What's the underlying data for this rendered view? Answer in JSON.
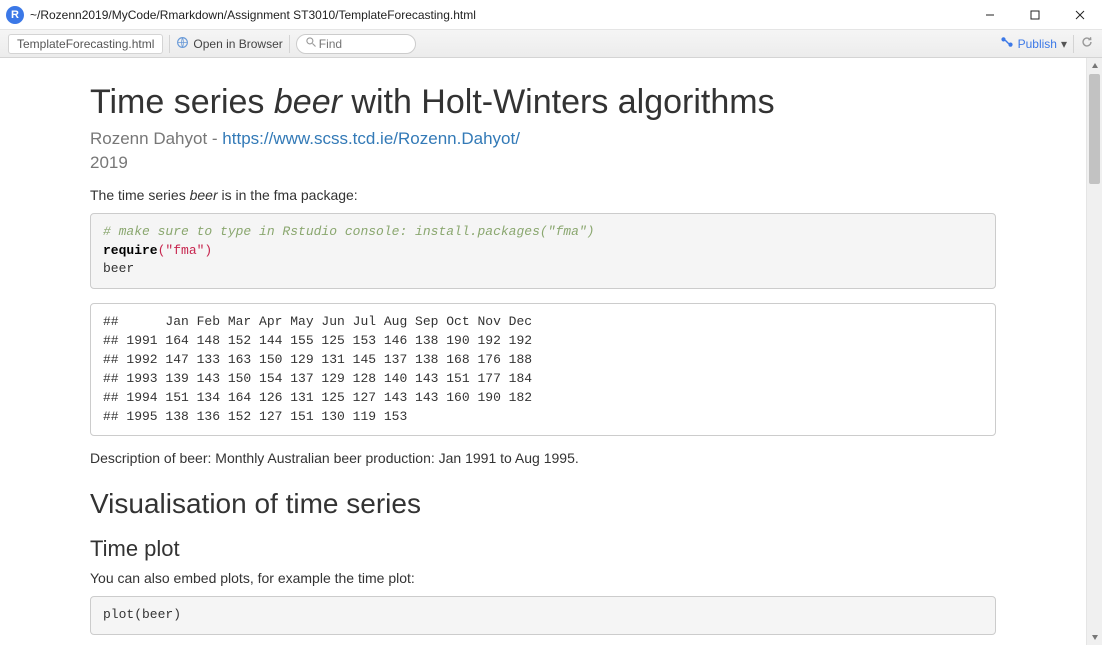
{
  "window": {
    "path": "~/Rozenn2019/MyCode/Rmarkdown/Assignment ST3010/TemplateForecasting.html",
    "app_icon_letter": "R"
  },
  "toolbar": {
    "tab_label": "TemplateForecasting.html",
    "open_in_browser": "Open in Browser",
    "find_placeholder": "Find",
    "publish_label": "Publish"
  },
  "doc": {
    "title_pre": "Time series ",
    "title_em": "beer",
    "title_post": " with Holt-Winters algorithms",
    "author_name": "Rozenn Dahyot - ",
    "author_link_text": "https://www.scss.tcd.ie/Rozenn.Dahyot/",
    "date": "2019",
    "intro_pre": "The time series ",
    "intro_em": "beer",
    "intro_post": " is in the fma package:",
    "code_comment": "# make sure to type in Rstudio console: install.packages(\"fma\")",
    "code_require": "require",
    "code_require_arg": "(\"fma\")",
    "code_line3": "beer",
    "output_block": "##      Jan Feb Mar Apr May Jun Jul Aug Sep Oct Nov Dec\n## 1991 164 148 152 144 155 125 153 146 138 190 192 192\n## 1992 147 133 163 150 129 131 145 137 138 168 176 188\n## 1993 139 143 150 154 137 129 128 140 143 151 177 184\n## 1994 151 134 164 126 131 125 127 143 143 160 190 182\n## 1995 138 136 152 127 151 130 119 153",
    "desc": "Description of beer: Monthly Australian beer production: Jan 1991 to Aug 1995.",
    "h2": "Visualisation of time series",
    "h3": "Time plot",
    "embed_text": "You can also embed plots, for example the time plot:",
    "code_plot": "plot(beer)"
  }
}
